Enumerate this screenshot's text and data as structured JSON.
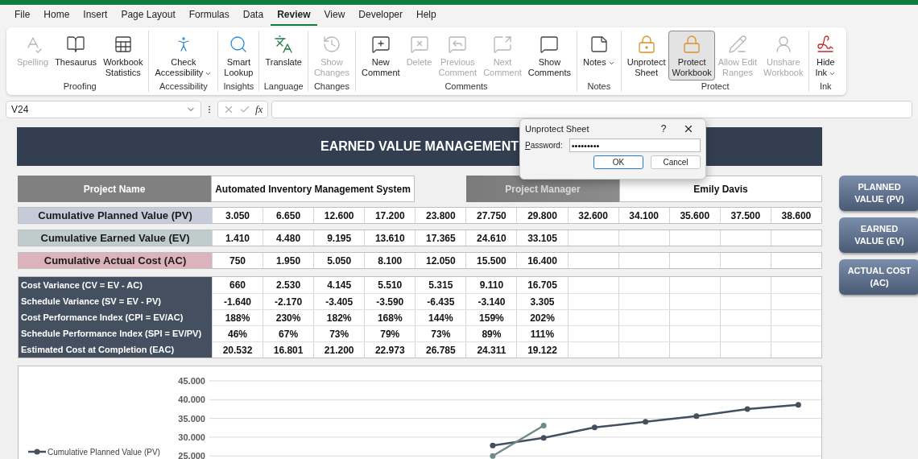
{
  "menu_tabs": [
    {
      "label": "File",
      "selected": false
    },
    {
      "label": "Home",
      "selected": false
    },
    {
      "label": "Insert",
      "selected": false
    },
    {
      "label": "Page Layout",
      "selected": false
    },
    {
      "label": "Formulas",
      "selected": false
    },
    {
      "label": "Data",
      "selected": false
    },
    {
      "label": "Review",
      "selected": true
    },
    {
      "label": "View",
      "selected": false
    },
    {
      "label": "Developer",
      "selected": false
    },
    {
      "label": "Help",
      "selected": false
    }
  ],
  "ribbon_groups": [
    {
      "label": "Proofing",
      "buttons": [
        {
          "kind": "spelling",
          "label": "Spelling",
          "disabled": true,
          "pressed": false
        },
        {
          "kind": "thesaurus",
          "label": "Thesaurus",
          "disabled": false,
          "pressed": false
        },
        {
          "kind": "statistics",
          "label": "Workbook\nStatistics",
          "disabled": false,
          "pressed": false
        }
      ]
    },
    {
      "label": "Accessibility",
      "buttons": [
        {
          "kind": "accessibility",
          "label": "Check\nAccessibility",
          "disabled": false,
          "pressed": false,
          "dropdown": true
        }
      ]
    },
    {
      "label": "Insights",
      "buttons": [
        {
          "kind": "lookup",
          "label": "Smart\nLookup",
          "disabled": false,
          "pressed": false
        }
      ]
    },
    {
      "label": "Language",
      "buttons": [
        {
          "kind": "translate",
          "label": "Translate",
          "disabled": false,
          "pressed": false
        }
      ]
    },
    {
      "label": "Changes",
      "buttons": [
        {
          "kind": "changes",
          "label": "Show\nChanges",
          "disabled": true,
          "pressed": false
        }
      ]
    },
    {
      "label": "Comments",
      "buttons": [
        {
          "kind": "new_comment",
          "label": "New\nComment",
          "disabled": false,
          "pressed": false
        },
        {
          "kind": "delete_comment",
          "label": "Delete",
          "disabled": true,
          "pressed": false
        },
        {
          "kind": "previous_comment",
          "label": "Previous\nComment",
          "disabled": true,
          "pressed": false
        },
        {
          "kind": "next_comment",
          "label": "Next\nComment",
          "disabled": true,
          "pressed": false
        },
        {
          "kind": "show_comments",
          "label": "Show\nComments",
          "disabled": false,
          "pressed": false
        }
      ]
    },
    {
      "label": "Notes",
      "buttons": [
        {
          "kind": "notes",
          "label": "Notes",
          "disabled": false,
          "pressed": false,
          "dropdown": true
        }
      ]
    },
    {
      "label": "Protect",
      "buttons": [
        {
          "kind": "unprotect_sheet",
          "label": "Unprotect\nSheet",
          "disabled": false,
          "pressed": false
        },
        {
          "kind": "protect_workbook",
          "label": "Protect\nWorkbook",
          "disabled": false,
          "pressed": true
        },
        {
          "kind": "allow_edit",
          "label": "Allow Edit\nRanges",
          "disabled": true,
          "pressed": false
        },
        {
          "kind": "unshare",
          "label": "Unshare\nWorkbook",
          "disabled": true,
          "pressed": false
        }
      ]
    },
    {
      "label": "Ink",
      "buttons": [
        {
          "kind": "ink",
          "label": "Hide\nInk",
          "disabled": false,
          "pressed": false,
          "dropdown": true
        }
      ]
    }
  ],
  "formula_bar": {
    "name_box": "V24",
    "fx": "fx"
  },
  "sheet": {
    "title": "EARNED VALUE MANAGEMENT",
    "project_name_label": "Project Name",
    "project_name": "Automated Inventory Management System",
    "project_manager_label": "Project Manager",
    "project_manager": "Emily Davis",
    "cumulative_rows": [
      {
        "label": "Cumulative Planned Value (PV)",
        "color": "#c5cbd8",
        "values": [
          "3.050",
          "6.650",
          "12.600",
          "17.200",
          "23.800",
          "27.750",
          "29.800",
          "32.600",
          "34.100",
          "35.600",
          "37.500",
          "38.600"
        ]
      },
      {
        "label": "Cumulative Earned Value (EV)",
        "color": "#c0cccb",
        "values": [
          "1.410",
          "4.480",
          "9.195",
          "13.610",
          "17.365",
          "24.610",
          "33.105"
        ]
      },
      {
        "label": "Cumulative Actual Cost (AC)",
        "color": "#dcb2bc",
        "values": [
          "750",
          "1.950",
          "5.050",
          "8.100",
          "12.050",
          "15.500",
          "16.400"
        ]
      }
    ],
    "metrics": [
      {
        "label": "Cost Variance (CV = EV - AC)",
        "values": [
          "660",
          "2.530",
          "4.145",
          "5.510",
          "5.315",
          "9.110",
          "16.705"
        ]
      },
      {
        "label": "Schedule Variance (SV = EV - PV)",
        "values": [
          "-1.640",
          "-2.170",
          "-3.405",
          "-3.590",
          "-6.435",
          "-3.140",
          "3.305"
        ]
      },
      {
        "label": "Cost Performance Index (CPI = EV/AC)",
        "values": [
          "188%",
          "230%",
          "182%",
          "168%",
          "144%",
          "159%",
          "202%"
        ]
      },
      {
        "label": "Schedule Performance Index (SPI = EV/PV)",
        "values": [
          "46%",
          "67%",
          "73%",
          "79%",
          "73%",
          "89%",
          "111%"
        ]
      },
      {
        "label": "Estimated Cost at Completion (EAC)",
        "values": [
          "20.532",
          "16.801",
          "21.200",
          "22.973",
          "26.785",
          "24.311",
          "19.122"
        ]
      }
    ],
    "chart_data": {
      "type": "line",
      "grid": true,
      "ylim": [
        25000,
        45000
      ],
      "yticks": [
        {
          "value": 25000,
          "label": "25.000"
        },
        {
          "value": 30000,
          "label": "30.000"
        },
        {
          "value": 35000,
          "label": "35.000"
        },
        {
          "value": 40000,
          "label": "40.000"
        },
        {
          "value": 45000,
          "label": "45.000"
        }
      ],
      "series": [
        {
          "name": "Cumulative Planned Value (PV)",
          "color": "#44505f",
          "marker": "circle",
          "values": [
            null,
            null,
            null,
            null,
            null,
            27800,
            29800,
            32600,
            34100,
            35600,
            37500,
            38600
          ]
        },
        {
          "color": "#6f8a86",
          "marker": "circle",
          "values": [
            null,
            null,
            null,
            null,
            null,
            25000,
            33100,
            null,
            null,
            null,
            null,
            null
          ]
        }
      ]
    },
    "side_buttons": [
      "PLANNED VALUE (PV)",
      "EARNED VALUE (EV)",
      "ACTUAL COST (AC)"
    ]
  },
  "dialog": {
    "title": "Unprotect Sheet",
    "help": "?",
    "password_label": "Password:",
    "password": "•••••••••",
    "buttons": [
      "OK",
      "Cancel"
    ]
  }
}
